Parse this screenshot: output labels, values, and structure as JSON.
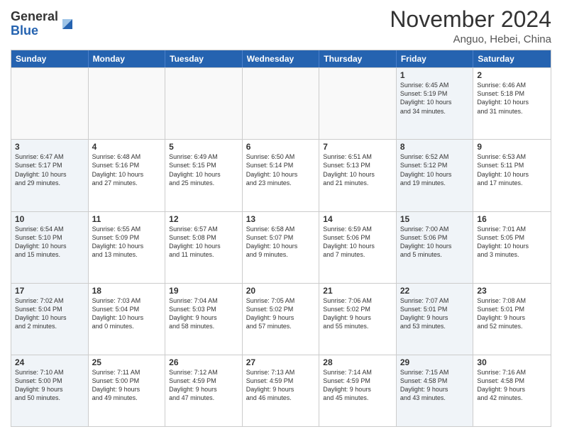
{
  "logo": {
    "general": "General",
    "blue": "Blue"
  },
  "header": {
    "month": "November 2024",
    "location": "Anguo, Hebei, China"
  },
  "weekdays": [
    "Sunday",
    "Monday",
    "Tuesday",
    "Wednesday",
    "Thursday",
    "Friday",
    "Saturday"
  ],
  "rows": [
    [
      {
        "day": "",
        "info": "",
        "empty": true
      },
      {
        "day": "",
        "info": "",
        "empty": true
      },
      {
        "day": "",
        "info": "",
        "empty": true
      },
      {
        "day": "",
        "info": "",
        "empty": true
      },
      {
        "day": "",
        "info": "",
        "empty": true
      },
      {
        "day": "1",
        "info": "Sunrise: 6:45 AM\nSunset: 5:19 PM\nDaylight: 10 hours\nand 34 minutes.",
        "shaded": true
      },
      {
        "day": "2",
        "info": "Sunrise: 6:46 AM\nSunset: 5:18 PM\nDaylight: 10 hours\nand 31 minutes.",
        "shaded": false
      }
    ],
    [
      {
        "day": "3",
        "info": "Sunrise: 6:47 AM\nSunset: 5:17 PM\nDaylight: 10 hours\nand 29 minutes.",
        "shaded": true
      },
      {
        "day": "4",
        "info": "Sunrise: 6:48 AM\nSunset: 5:16 PM\nDaylight: 10 hours\nand 27 minutes.",
        "shaded": false
      },
      {
        "day": "5",
        "info": "Sunrise: 6:49 AM\nSunset: 5:15 PM\nDaylight: 10 hours\nand 25 minutes.",
        "shaded": false
      },
      {
        "day": "6",
        "info": "Sunrise: 6:50 AM\nSunset: 5:14 PM\nDaylight: 10 hours\nand 23 minutes.",
        "shaded": false
      },
      {
        "day": "7",
        "info": "Sunrise: 6:51 AM\nSunset: 5:13 PM\nDaylight: 10 hours\nand 21 minutes.",
        "shaded": false
      },
      {
        "day": "8",
        "info": "Sunrise: 6:52 AM\nSunset: 5:12 PM\nDaylight: 10 hours\nand 19 minutes.",
        "shaded": true
      },
      {
        "day": "9",
        "info": "Sunrise: 6:53 AM\nSunset: 5:11 PM\nDaylight: 10 hours\nand 17 minutes.",
        "shaded": false
      }
    ],
    [
      {
        "day": "10",
        "info": "Sunrise: 6:54 AM\nSunset: 5:10 PM\nDaylight: 10 hours\nand 15 minutes.",
        "shaded": true
      },
      {
        "day": "11",
        "info": "Sunrise: 6:55 AM\nSunset: 5:09 PM\nDaylight: 10 hours\nand 13 minutes.",
        "shaded": false
      },
      {
        "day": "12",
        "info": "Sunrise: 6:57 AM\nSunset: 5:08 PM\nDaylight: 10 hours\nand 11 minutes.",
        "shaded": false
      },
      {
        "day": "13",
        "info": "Sunrise: 6:58 AM\nSunset: 5:07 PM\nDaylight: 10 hours\nand 9 minutes.",
        "shaded": false
      },
      {
        "day": "14",
        "info": "Sunrise: 6:59 AM\nSunset: 5:06 PM\nDaylight: 10 hours\nand 7 minutes.",
        "shaded": false
      },
      {
        "day": "15",
        "info": "Sunrise: 7:00 AM\nSunset: 5:06 PM\nDaylight: 10 hours\nand 5 minutes.",
        "shaded": true
      },
      {
        "day": "16",
        "info": "Sunrise: 7:01 AM\nSunset: 5:05 PM\nDaylight: 10 hours\nand 3 minutes.",
        "shaded": false
      }
    ],
    [
      {
        "day": "17",
        "info": "Sunrise: 7:02 AM\nSunset: 5:04 PM\nDaylight: 10 hours\nand 2 minutes.",
        "shaded": true
      },
      {
        "day": "18",
        "info": "Sunrise: 7:03 AM\nSunset: 5:04 PM\nDaylight: 10 hours\nand 0 minutes.",
        "shaded": false
      },
      {
        "day": "19",
        "info": "Sunrise: 7:04 AM\nSunset: 5:03 PM\nDaylight: 9 hours\nand 58 minutes.",
        "shaded": false
      },
      {
        "day": "20",
        "info": "Sunrise: 7:05 AM\nSunset: 5:02 PM\nDaylight: 9 hours\nand 57 minutes.",
        "shaded": false
      },
      {
        "day": "21",
        "info": "Sunrise: 7:06 AM\nSunset: 5:02 PM\nDaylight: 9 hours\nand 55 minutes.",
        "shaded": false
      },
      {
        "day": "22",
        "info": "Sunrise: 7:07 AM\nSunset: 5:01 PM\nDaylight: 9 hours\nand 53 minutes.",
        "shaded": true
      },
      {
        "day": "23",
        "info": "Sunrise: 7:08 AM\nSunset: 5:01 PM\nDaylight: 9 hours\nand 52 minutes.",
        "shaded": false
      }
    ],
    [
      {
        "day": "24",
        "info": "Sunrise: 7:10 AM\nSunset: 5:00 PM\nDaylight: 9 hours\nand 50 minutes.",
        "shaded": true
      },
      {
        "day": "25",
        "info": "Sunrise: 7:11 AM\nSunset: 5:00 PM\nDaylight: 9 hours\nand 49 minutes.",
        "shaded": false
      },
      {
        "day": "26",
        "info": "Sunrise: 7:12 AM\nSunset: 4:59 PM\nDaylight: 9 hours\nand 47 minutes.",
        "shaded": false
      },
      {
        "day": "27",
        "info": "Sunrise: 7:13 AM\nSunset: 4:59 PM\nDaylight: 9 hours\nand 46 minutes.",
        "shaded": false
      },
      {
        "day": "28",
        "info": "Sunrise: 7:14 AM\nSunset: 4:59 PM\nDaylight: 9 hours\nand 45 minutes.",
        "shaded": false
      },
      {
        "day": "29",
        "info": "Sunrise: 7:15 AM\nSunset: 4:58 PM\nDaylight: 9 hours\nand 43 minutes.",
        "shaded": true
      },
      {
        "day": "30",
        "info": "Sunrise: 7:16 AM\nSunset: 4:58 PM\nDaylight: 9 hours\nand 42 minutes.",
        "shaded": false
      }
    ]
  ]
}
